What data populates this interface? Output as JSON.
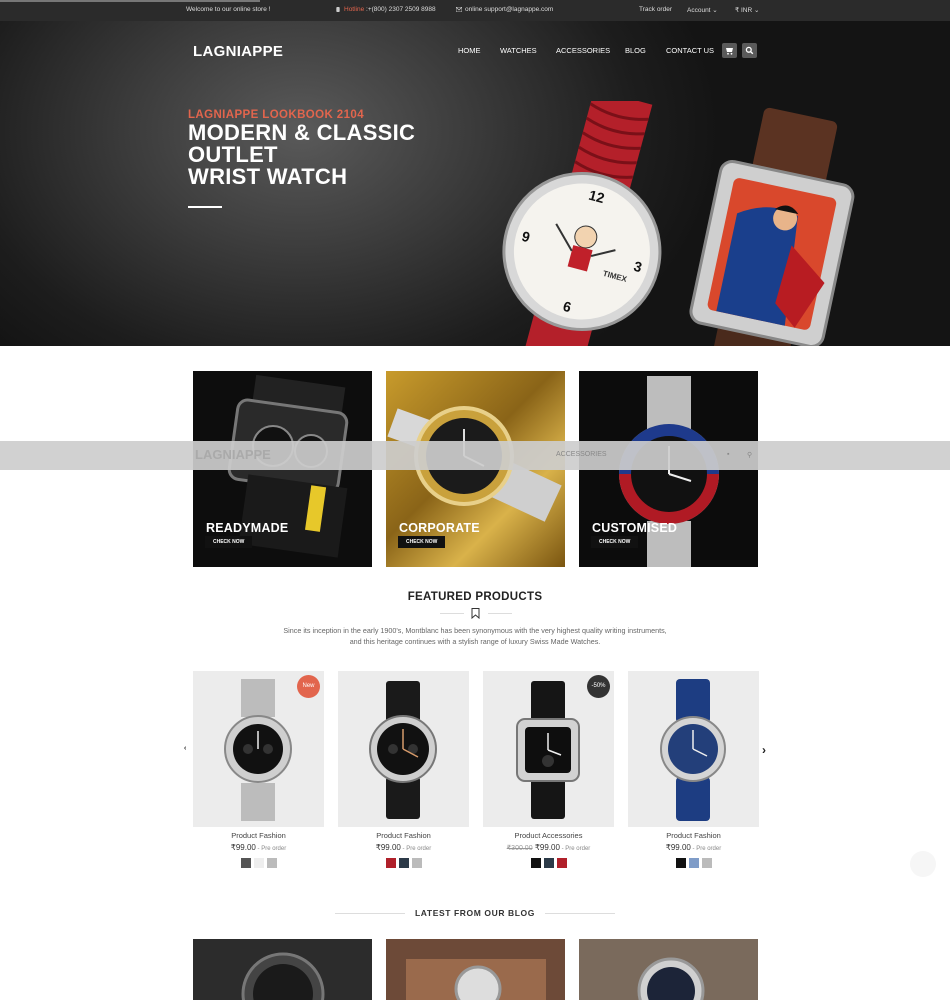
{
  "topbar": {
    "welcome": "Welcome to our online store !",
    "hotline_label": "Hotline",
    "hotline_number": " :+(800) 2307 2509 8988",
    "email": "online support@lagnappe.com",
    "track": "Track order",
    "account": "Account ⌄",
    "currency": "₹ INR ⌄"
  },
  "header": {
    "logo": "LAGNIAPPE",
    "nav": [
      "HOME",
      "WATCHES",
      "ACCESSORIES",
      "BLOG",
      "CONTACT US"
    ]
  },
  "hero": {
    "subtitle": "LAGNIAPPE LOOKBOOK 2104",
    "title_line1": "MODERN & CLASSIC",
    "title_line2": "OUTLET",
    "title_line3": "WRIST WATCH",
    "watch_brand": "TIMEX"
  },
  "sticky": {
    "logo": "LAGNIAPPE",
    "nav": "ACCESSORIES"
  },
  "categories": [
    {
      "label": "READYMADE",
      "button": "CHECK NOW"
    },
    {
      "label": "CORPORATE",
      "button": "CHECK NOW"
    },
    {
      "label": "CUSTOMISED",
      "button": "CHECK NOW"
    }
  ],
  "featured": {
    "title": "FEATURED PRODUCTS",
    "line1": "Since its inception in the early 1900's, Montblanc has been synonymous with the very highest quality writing instruments,",
    "line2": "and this heritage continues with a stylish range of luxury Swiss Made Watches."
  },
  "products": [
    {
      "name": "Product Fashion",
      "price": "₹99.00",
      "note": " - Pre order",
      "badge": "New",
      "badge_color": "#e2654d",
      "swatches": [
        "#555555",
        "#eeeeee",
        "#bbbbbb"
      ]
    },
    {
      "name": "Product Fashion",
      "price": "₹99.00",
      "note": " - Pre order",
      "swatches": [
        "#b0202a",
        "#2c3a48",
        "#bbbbbb"
      ]
    },
    {
      "name": "Product Accessories",
      "old_price": "₹300.00",
      "price": "₹99.00",
      "note": " - Pre order",
      "badge": "-50%",
      "badge_color": "#333333",
      "swatches": [
        "#111111",
        "#2c3a48",
        "#b0202a"
      ]
    },
    {
      "name": "Product Fashion",
      "price": "₹99.00",
      "note": " - Pre order",
      "swatches": [
        "#111111",
        "#7f9cc8",
        "#bbbbbb"
      ]
    }
  ],
  "blog": {
    "title": "LATEST FROM OUR BLOG"
  },
  "icons": {
    "cart": "cart-icon",
    "search": "search-icon",
    "bookmark": "bookmark-icon",
    "prev": "chevron-left-icon",
    "next": "chevron-right-icon"
  },
  "colors": {
    "accent": "#e2654d",
    "dark": "#1d1d1d"
  }
}
